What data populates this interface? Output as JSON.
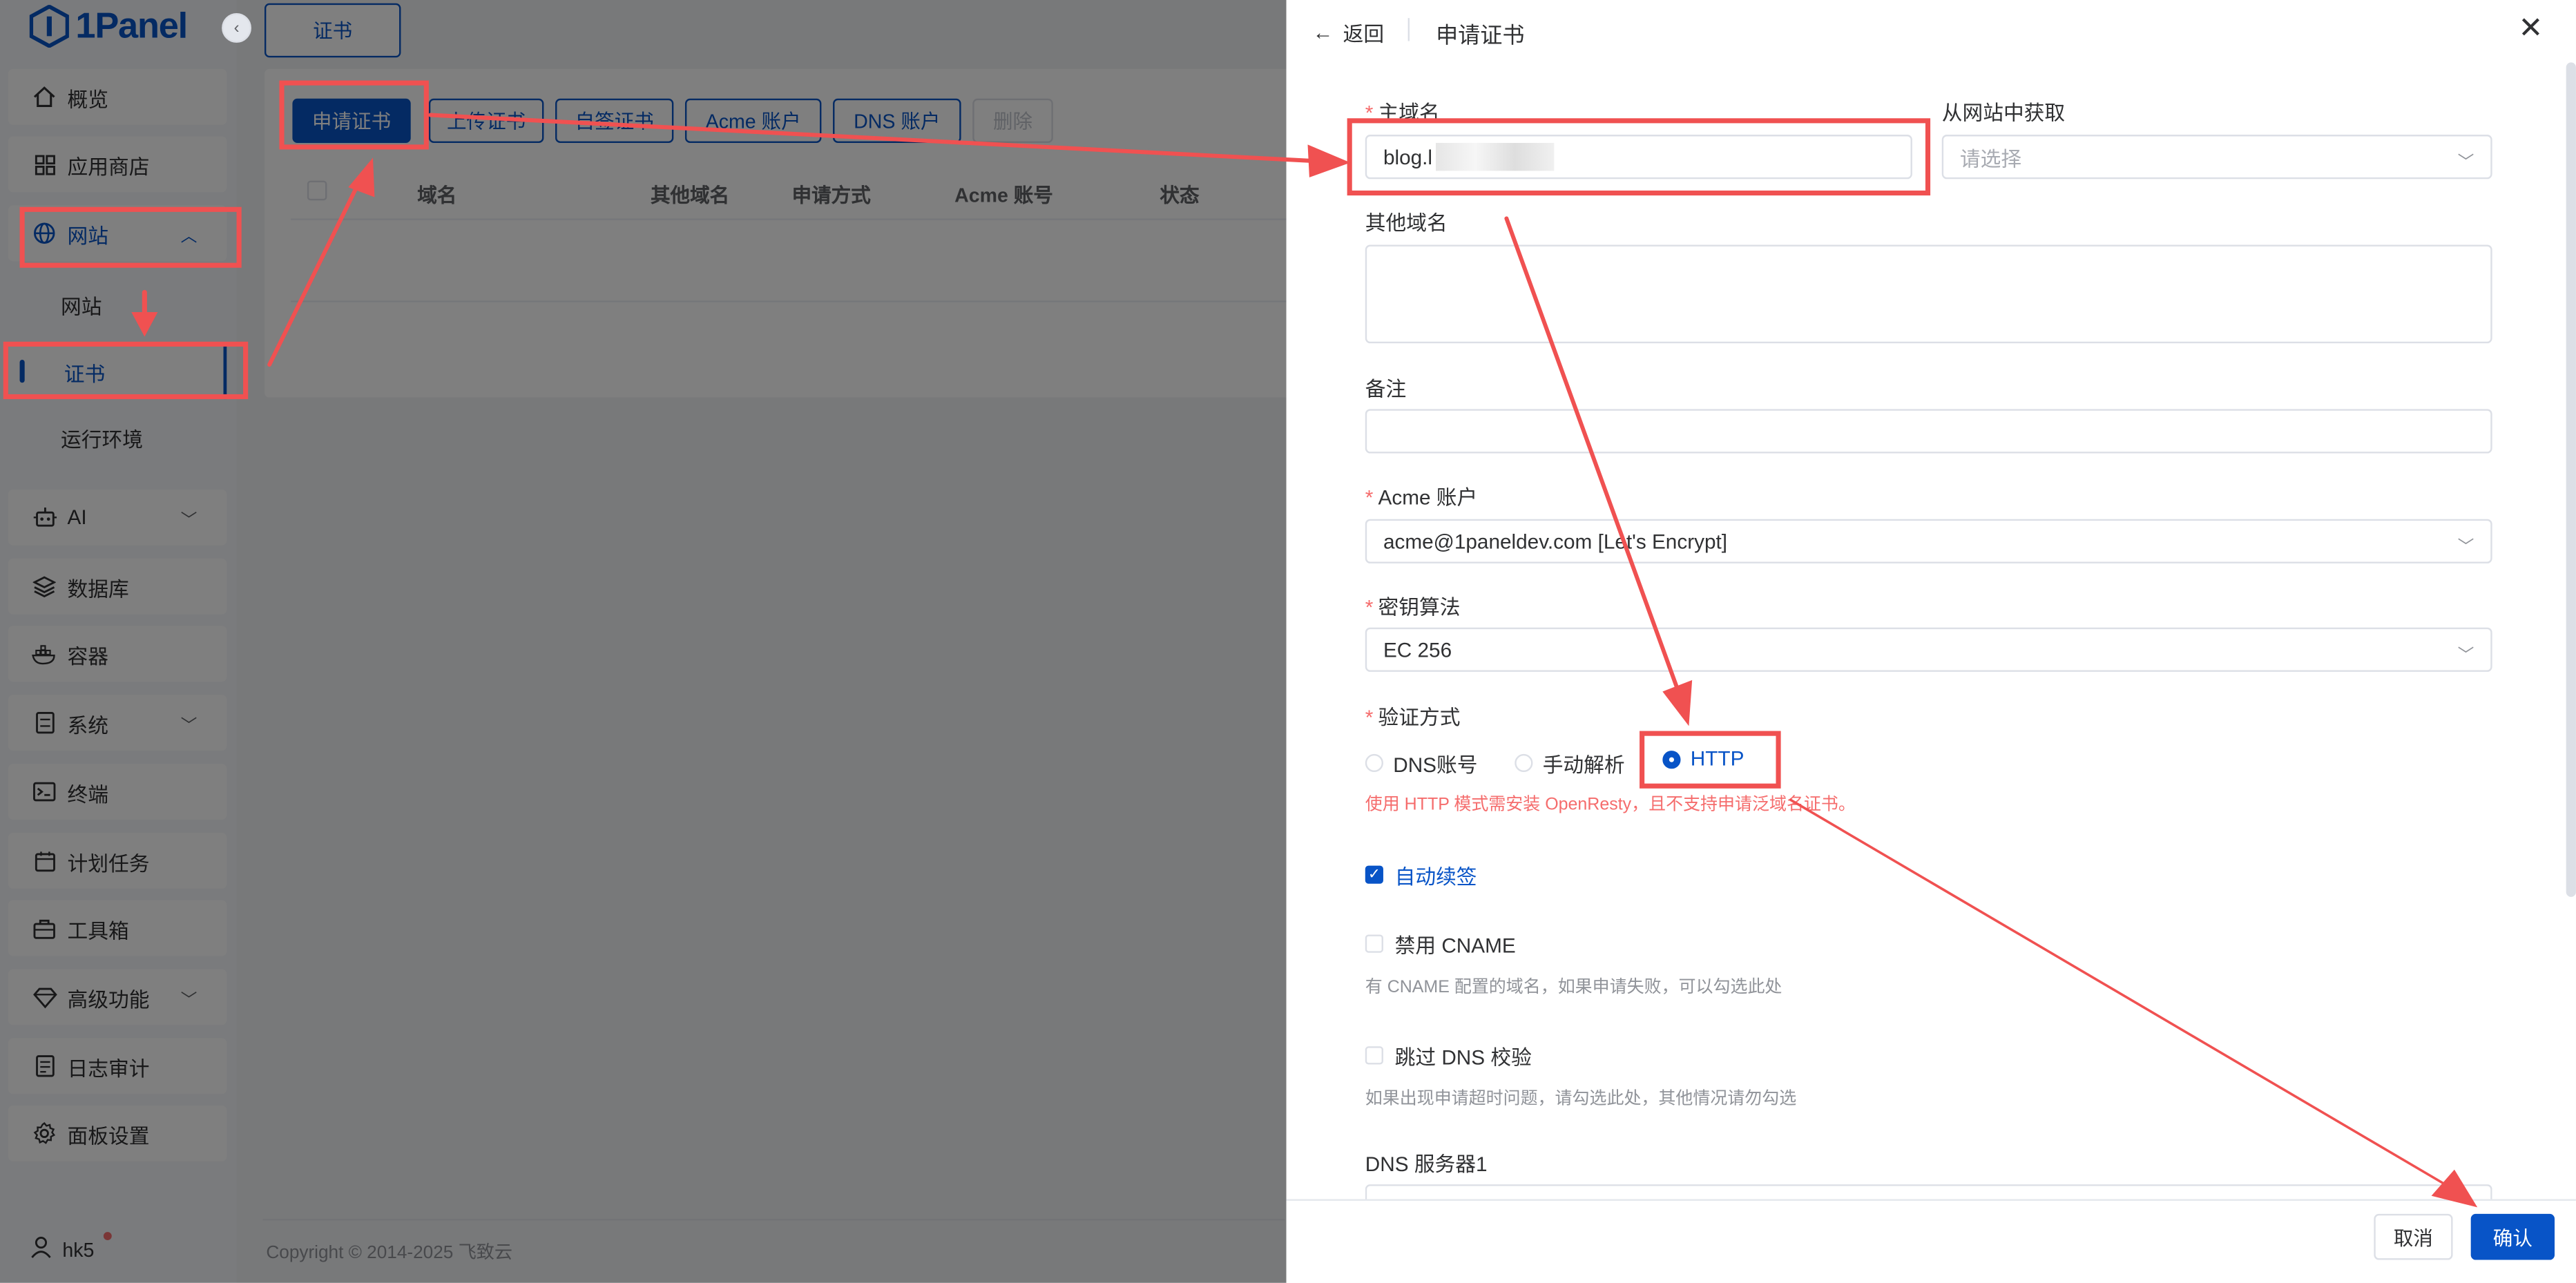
{
  "app": {
    "logo_text": "1Panel"
  },
  "sidebar": {
    "items": [
      {
        "label": "概览",
        "icon": "home-icon"
      },
      {
        "label": "应用商店",
        "icon": "grid-icon"
      },
      {
        "label": "网站",
        "icon": "globe-icon"
      },
      {
        "label": "网站"
      },
      {
        "label": "证书"
      },
      {
        "label": "运行环境"
      },
      {
        "label": "AI",
        "icon": "robot-icon"
      },
      {
        "label": "数据库",
        "icon": "layers-icon"
      },
      {
        "label": "容器",
        "icon": "docker-icon"
      },
      {
        "label": "系统",
        "icon": "server-icon"
      },
      {
        "label": "终端",
        "icon": "terminal-icon"
      },
      {
        "label": "计划任务",
        "icon": "calendar-icon"
      },
      {
        "label": "工具箱",
        "icon": "toolbox-icon"
      },
      {
        "label": "高级功能",
        "icon": "diamond-icon"
      },
      {
        "label": "日志审计",
        "icon": "log-icon"
      },
      {
        "label": "面板设置",
        "icon": "gear-icon"
      }
    ],
    "user": "hk5"
  },
  "main": {
    "tab": "证书",
    "toolbar": {
      "apply": "申请证书",
      "upload": "上传证书",
      "selfsign": "自签证书",
      "acme": "Acme 账户",
      "dns": "DNS 账户",
      "delete": "删除"
    },
    "columns": [
      "域名",
      "其他域名",
      "申请方式",
      "Acme 账号",
      "状态"
    ],
    "footer": "Copyright © 2014-2025 飞致云"
  },
  "drawer": {
    "back": "返回",
    "title": "申请证书",
    "primary_domain": {
      "label": "主域名",
      "value": "blog.l"
    },
    "from_site": {
      "label": "从网站中获取",
      "placeholder": "请选择"
    },
    "other_domains": {
      "label": "其他域名"
    },
    "remark": {
      "label": "备注"
    },
    "acme_account": {
      "label": "Acme 账户",
      "value": "acme@1paneldev.com [Let's Encrypt]"
    },
    "key_algo": {
      "label": "密钥算法",
      "value": "EC 256"
    },
    "verify": {
      "label": "验证方式",
      "options": [
        "DNS账号",
        "手动解析",
        "HTTP"
      ],
      "selected": "HTTP",
      "warning": "使用 HTTP 模式需安装 OpenResty，且不支持申请泛域名证书。"
    },
    "auto_renew": {
      "label": "自动续签",
      "checked": true
    },
    "disable_cname": {
      "label": "禁用 CNAME",
      "checked": false,
      "hint": "有 CNAME 配置的域名，如果申请失败，可以勾选此处"
    },
    "skip_dns": {
      "label": "跳过 DNS 校验",
      "checked": false,
      "hint": "如果出现申请超时问题，请勾选此处，其他情况请勿勾选"
    },
    "dns_server1": {
      "label": "DNS 服务器1"
    },
    "cancel": "取消",
    "confirm": "确认"
  },
  "colors": {
    "primary": "#0854c7",
    "annotation": "#f05151",
    "danger": "#f56c6c"
  }
}
